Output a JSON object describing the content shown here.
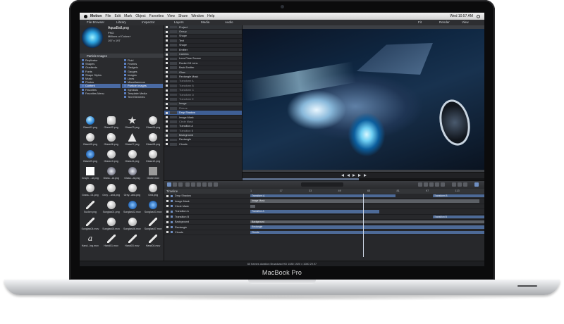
{
  "device": {
    "label": "MacBook Pro"
  },
  "menubar": {
    "app": "Motion",
    "items": [
      "File",
      "Edit",
      "Mark",
      "Object",
      "Favorites",
      "View",
      "Share",
      "Window",
      "Help"
    ],
    "clock": "Wed 10:57 AM"
  },
  "panels": {
    "left_tabs": [
      "File Browser",
      "Library",
      "Inspector"
    ],
    "center_tabs": [
      "Layers",
      "Media",
      "Audio"
    ],
    "view_controls": [
      "Fit",
      "Render",
      "View"
    ]
  },
  "preview": {
    "title": "AquaBall.png",
    "lines": [
      "PNG",
      "Millions of Colors+",
      "197 x 197"
    ]
  },
  "library": {
    "header": "Particle Images",
    "categories_left": [
      "Replicator",
      "Shapes",
      "Gradients",
      "Fonts",
      "Shape Styles",
      "Music",
      "Photos",
      "Content",
      "Favorites",
      "Favorites Menu"
    ],
    "categories_right": [
      "Fluid",
      "Frames",
      "Gadgets",
      "Gauges",
      "Images",
      "Lines",
      "Miscellaneous",
      "Particle Images",
      "Symbols",
      "Template Media",
      "Text Elements"
    ],
    "selected_left": "Content",
    "selected_right": "Particle Images",
    "thumbnails": [
      {
        "label": "Glass01.png",
        "shape": "sphere"
      },
      {
        "label": "Glass02.png",
        "shape": "white rounded"
      },
      {
        "label": "Glass03.png",
        "shape": "star"
      },
      {
        "label": "Glass04.png",
        "shape": "white"
      },
      {
        "label": "Glass05.png",
        "shape": "white"
      },
      {
        "label": "Glass06.png",
        "shape": "white blob"
      },
      {
        "label": "Glass07.png",
        "shape": "white tri"
      },
      {
        "label": "Glass08.png",
        "shape": "white"
      },
      {
        "label": "Glass09.png",
        "shape": "blue"
      },
      {
        "label": "Glass10.png",
        "shape": "white"
      },
      {
        "label": "Glass11.png",
        "shape": "white"
      },
      {
        "label": "Glass12.png",
        "shape": "white"
      },
      {
        "label": "Graph ...at.png",
        "shape": "sq"
      },
      {
        "label": "Glass...at.png",
        "shape": "smoke"
      },
      {
        "label": "Glass...at.png",
        "shape": "smoke"
      },
      {
        "label": "Globe.mov",
        "shape": "dark"
      },
      {
        "label": "Grass...01.png",
        "shape": "white"
      },
      {
        "label": "Grey ...and.png",
        "shape": "white"
      },
      {
        "label": "Grey...and.png",
        "shape": "white"
      },
      {
        "label": "Grid.png",
        "shape": "white"
      },
      {
        "label": "Sucker.png",
        "shape": "brush"
      },
      {
        "label": "Sunglas01.png",
        "shape": "white"
      },
      {
        "label": "Sunglas02.mov",
        "shape": "blue"
      },
      {
        "label": "Sunglas03.mov",
        "shape": "blue"
      },
      {
        "label": "Sunglas04.mov",
        "shape": "brush"
      },
      {
        "label": "Sunglas05.mov",
        "shape": "white"
      },
      {
        "label": "Sunglas06.mov",
        "shape": "white"
      },
      {
        "label": "Sunglas07.mov",
        "shape": "brush"
      },
      {
        "label": "Hand...ing.mov",
        "shape": "letter"
      },
      {
        "label": "Hand01.mov",
        "shape": "brush"
      },
      {
        "label": "Hand03.mov",
        "shape": "brush"
      },
      {
        "label": "Hand04.mov",
        "shape": "brush"
      }
    ]
  },
  "layers": [
    {
      "name": "Project",
      "kind": "group"
    },
    {
      "name": "Group",
      "kind": "group"
    },
    {
      "name": "Shape",
      "kind": "item"
    },
    {
      "name": "Text",
      "kind": "item"
    },
    {
      "name": "Shape",
      "kind": "item"
    },
    {
      "name": "Emitter",
      "kind": "item"
    },
    {
      "name": "Camera",
      "kind": "group"
    },
    {
      "name": "Lens Flare Source",
      "kind": "item"
    },
    {
      "name": "Rocket 15 Lens",
      "kind": "item"
    },
    {
      "name": "Back Emitter",
      "kind": "item"
    },
    {
      "name": "Glow",
      "kind": "group"
    },
    {
      "name": "Rectangle Mask",
      "kind": "item"
    },
    {
      "name": "Transform A",
      "kind": "dim"
    },
    {
      "name": "Transform B",
      "kind": "dim"
    },
    {
      "name": "Transform C",
      "kind": "dim"
    },
    {
      "name": "Transform D",
      "kind": "dim"
    },
    {
      "name": "Transform E",
      "kind": "dim"
    },
    {
      "name": "Image",
      "kind": "group"
    },
    {
      "name": "Picture",
      "kind": "dim"
    },
    {
      "name": "Drop Shadow",
      "kind": "selected"
    },
    {
      "name": "Image Mask",
      "kind": "item"
    },
    {
      "name": "Circle Mask",
      "kind": "dim"
    },
    {
      "name": "Transition A",
      "kind": "item"
    },
    {
      "name": "Transition B",
      "kind": "dim"
    },
    {
      "name": "Background",
      "kind": "group"
    },
    {
      "name": "Rectangle",
      "kind": "item"
    },
    {
      "name": "Clouds",
      "kind": "item"
    }
  ],
  "timeline": {
    "title": "Timeline",
    "ruler": [
      "1",
      "17",
      "33",
      "49",
      "65",
      "81",
      "97",
      "113"
    ],
    "rows": [
      {
        "name": "Drop Shadow",
        "bars": [
          {
            "label": "Drop Shadow",
            "start": 0,
            "end": 0.48,
            "grey": true
          },
          {
            "label": "Transform A",
            "start": 0.0,
            "end": 0.62,
            "grey": false
          },
          {
            "label": "Transform B",
            "start": 0.78,
            "end": 1.0,
            "grey": false
          }
        ]
      },
      {
        "name": "Image Mask",
        "bars": [
          {
            "label": "Image Mask",
            "start": 0,
            "end": 0.98,
            "grey": true
          }
        ]
      },
      {
        "name": "Circle Mask",
        "bars": [
          {
            "label": "",
            "start": 0.0,
            "end": 0.02,
            "grey": true
          }
        ]
      },
      {
        "name": "Transition A",
        "bars": [
          {
            "label": "Transition A",
            "start": 0,
            "end": 0.55,
            "grey": false
          }
        ]
      },
      {
        "name": "Transition B",
        "bars": [
          {
            "label": "Transition B",
            "start": 0.78,
            "end": 1.0,
            "grey": false
          }
        ]
      },
      {
        "name": "Background",
        "bars": [
          {
            "label": "Background",
            "start": 0,
            "end": 1.0,
            "grey": true
          }
        ]
      },
      {
        "name": "Rectangle",
        "bars": [
          {
            "label": "Rectangle",
            "start": 0,
            "end": 1.0,
            "grey": false
          }
        ]
      },
      {
        "name": "Clouds",
        "bars": [
          {
            "label": "Clouds",
            "start": 0,
            "end": 1.0,
            "grey": false
          }
        ]
      }
    ]
  },
  "status": {
    "text": "60 frames duration Broadcast HD 1080 1920 x 1080 29.97"
  }
}
